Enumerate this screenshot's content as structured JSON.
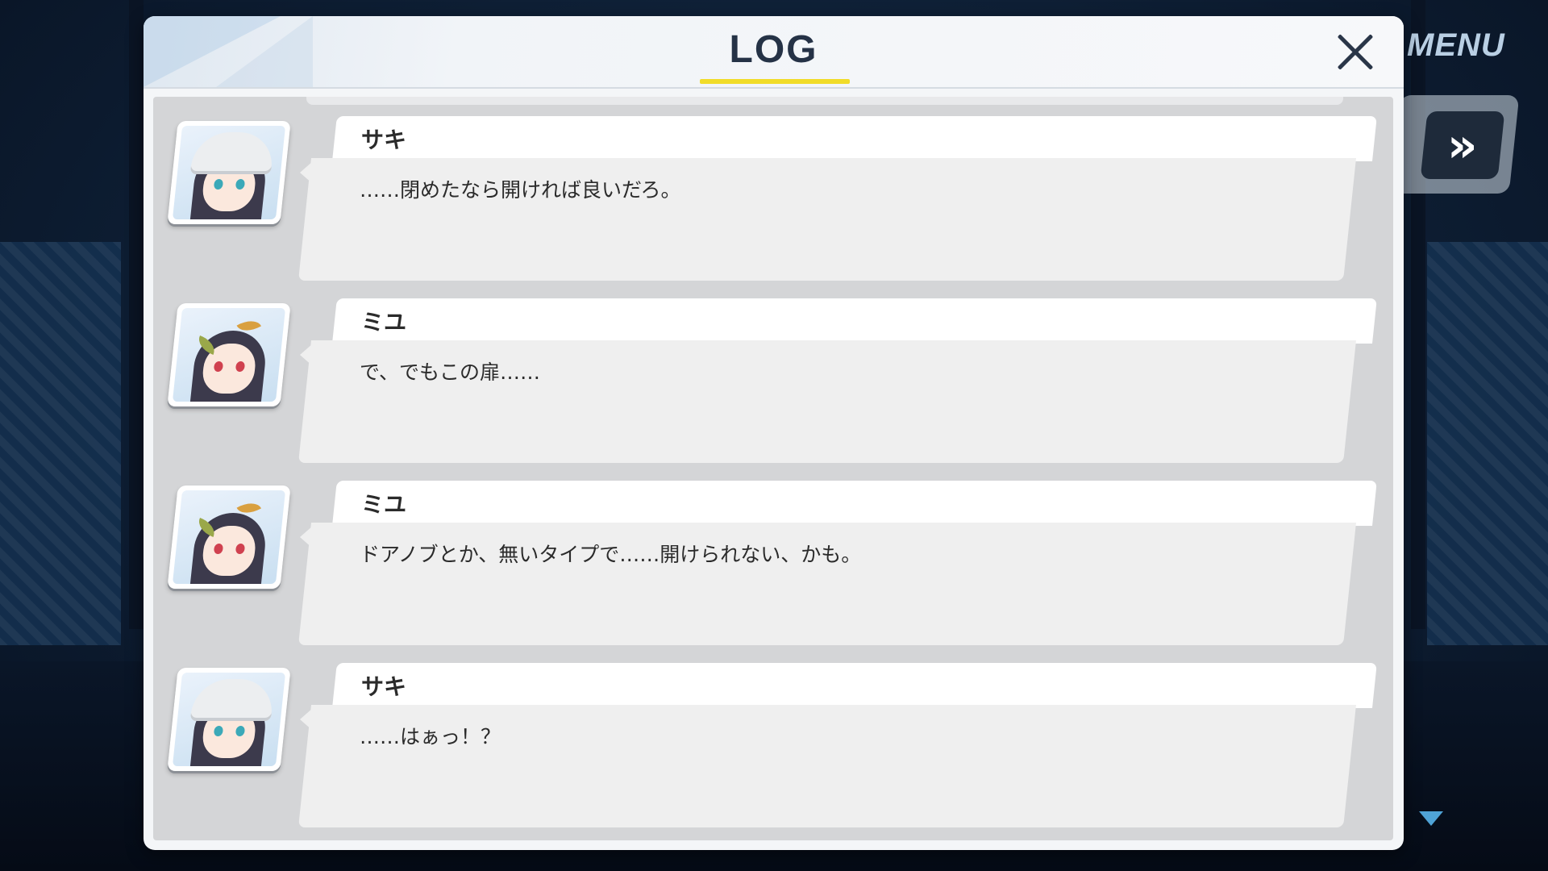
{
  "hud": {
    "menu_label": "MENU",
    "fast_forward_glyph": "»"
  },
  "log": {
    "title": "LOG",
    "close_glyph": "×",
    "entries": [
      {
        "speaker": "サキ",
        "text": "……閉めたなら開ければ良いだろ。",
        "portrait": "saki-portrait"
      },
      {
        "speaker": "ミユ",
        "text": "で、でもこの扉……",
        "portrait": "miyu-portrait"
      },
      {
        "speaker": "ミユ",
        "text": "ドアノブとか、無いタイプで……開けられない、かも。",
        "portrait": "miyu-portrait"
      },
      {
        "speaker": "サキ",
        "text": "……はぁっ！？",
        "portrait": "saki-portrait"
      }
    ]
  },
  "colors": {
    "title_underline": "#f1dc2a",
    "scroll_indicator": "#4fa3d6",
    "title_text": "#253246"
  }
}
